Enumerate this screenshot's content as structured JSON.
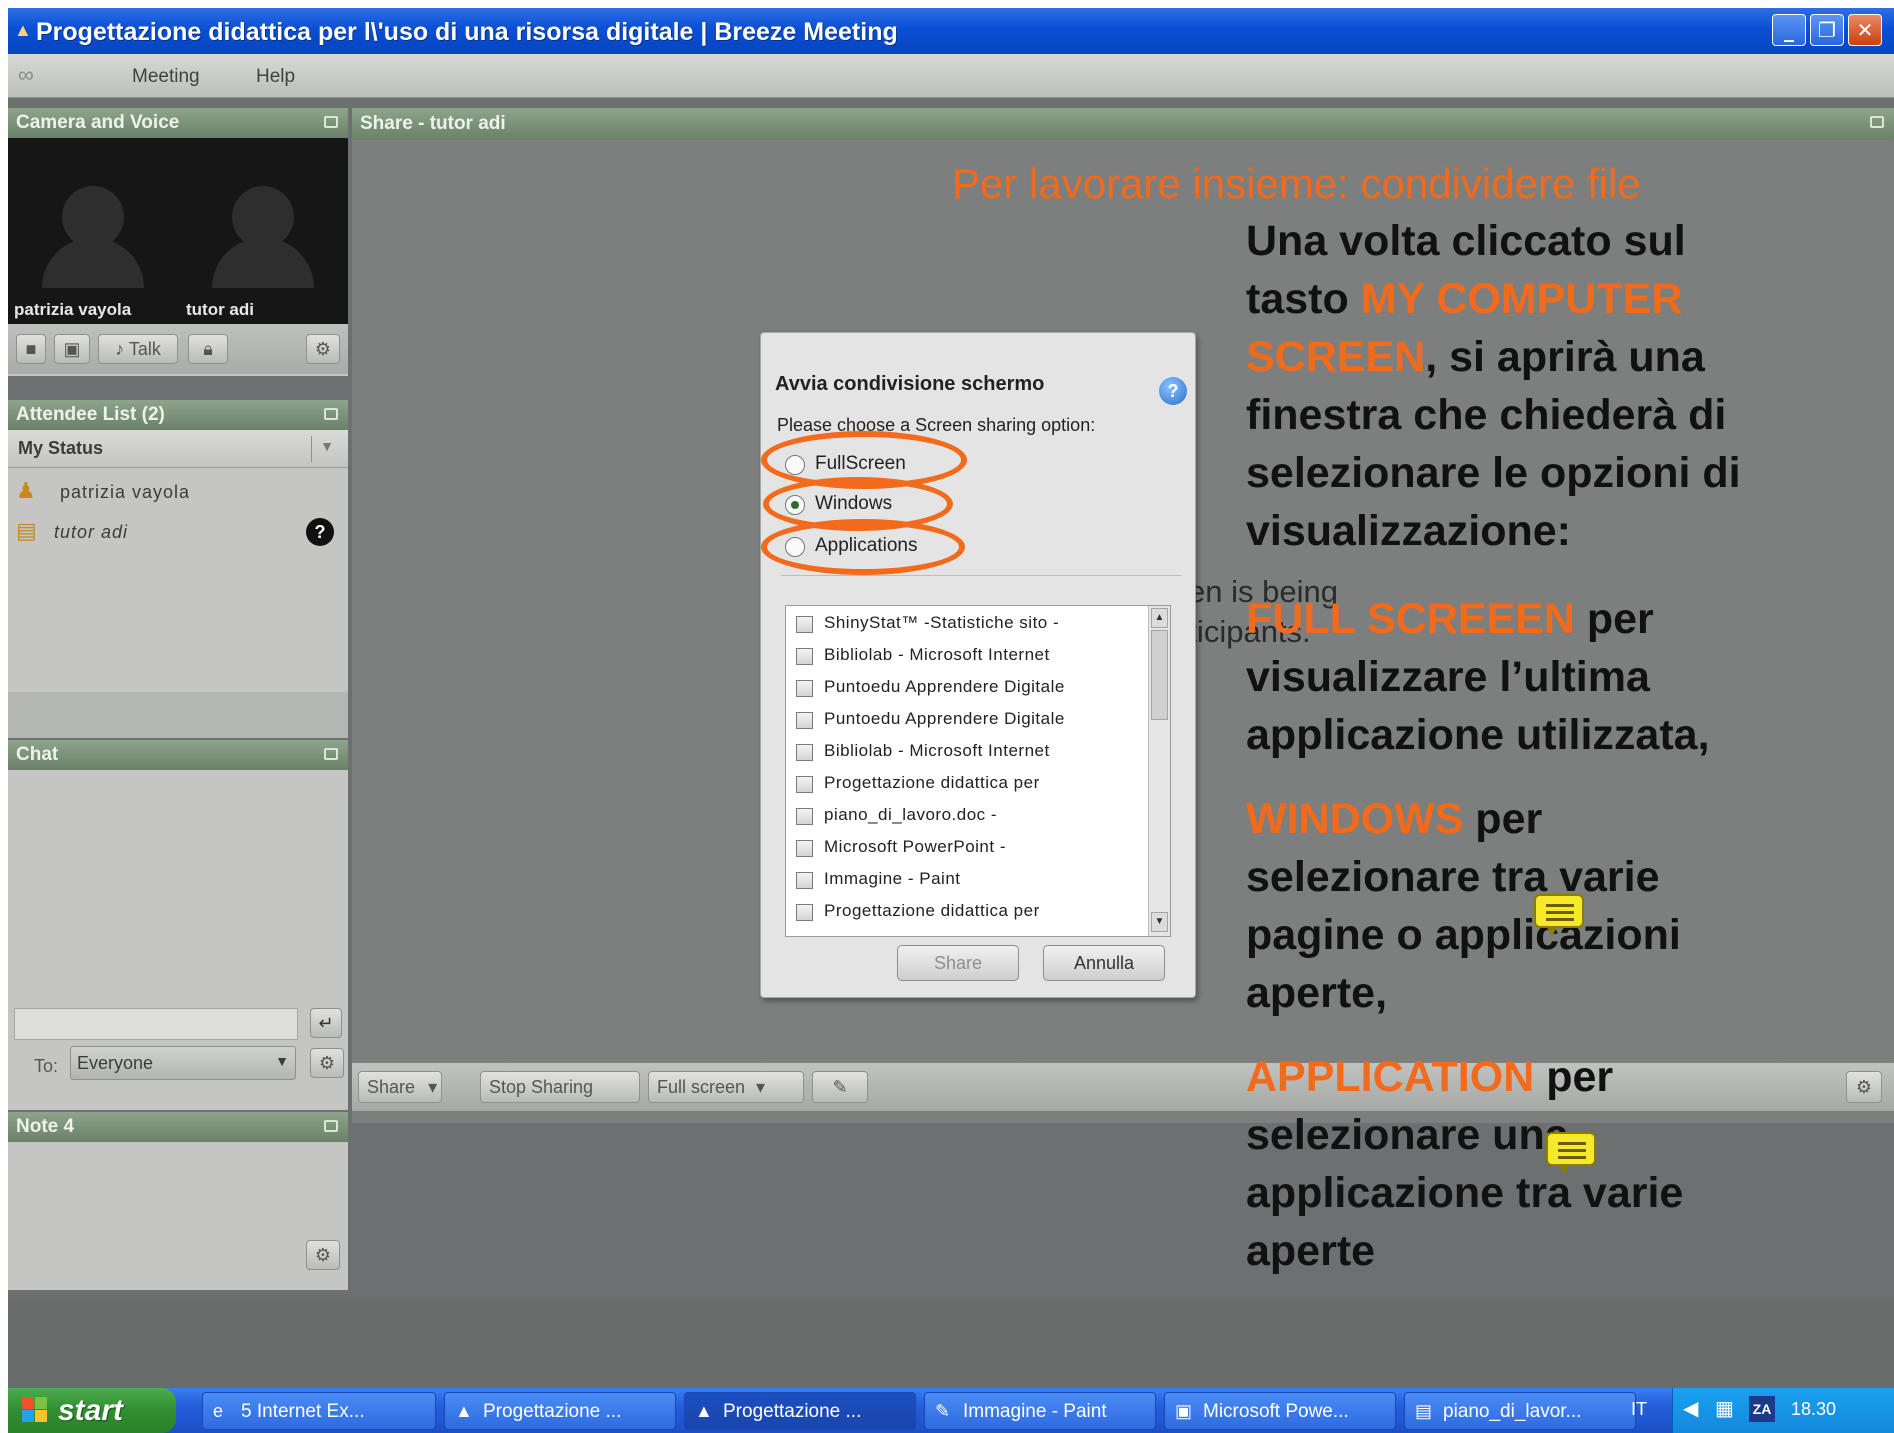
{
  "window": {
    "title": "Progettazione didattica per l\\'uso di una risorsa digitale | Breeze Meeting",
    "minimize": "_",
    "restore": "❐",
    "close": "✕"
  },
  "menu": {
    "logo": "∞",
    "items": [
      "Meeting",
      "Help"
    ]
  },
  "camera_pod": {
    "title": "Camera and Voice",
    "participants": [
      "patrizia vayola",
      "tutor adi"
    ],
    "talk_label": "Talk"
  },
  "attendee_pod": {
    "title": "Attendee List (2)",
    "status_label": "My Status",
    "attendees": [
      {
        "name": "patrizia vayola"
      },
      {
        "name": "tutor adi",
        "badge": "?"
      }
    ]
  },
  "chat_pod": {
    "title": "Chat",
    "to_label": "To:",
    "recipient": "Everyone"
  },
  "note_pod": {
    "title": "Note 4"
  },
  "share_pod": {
    "title": "Share - tutor adi",
    "background_text": [
      "en is being",
      "rticipants."
    ],
    "toolbar": {
      "share": "Share",
      "stop": "Stop Sharing",
      "fullscreen": "Full screen"
    }
  },
  "dialog": {
    "title": "Avvia condivisione schermo",
    "prompt": "Please choose a Screen sharing option:",
    "options": [
      "FullScreen",
      "Windows",
      "Applications"
    ],
    "selected": "Windows",
    "windows": [
      "ShinyStat™ -Statistiche sito -",
      "Bibliolab - Microsoft Internet",
      "Puntoedu Apprendere Digitale",
      "Puntoedu Apprendere Digitale",
      "Bibliolab - Microsoft Internet",
      "Progettazione didattica per",
      "piano_di_lavoro.doc -",
      "Microsoft PowerPoint -",
      "Immagine - Paint",
      "Progettazione didattica per"
    ],
    "share_button": "Share",
    "cancel_button": "Annulla"
  },
  "annotation": {
    "heading": "Per lavorare insieme: condividere file",
    "intro": [
      "Una volta cliccato sul",
      "tasto ",
      "MY COMPUTER",
      "SCREEN",
      ", si aprirà una",
      "finestra che chiederà di",
      "selezionare le opzioni di",
      "visualizzazione:"
    ],
    "full_screen": [
      "FULL SCREEEN",
      " per",
      "visualizzare l’ultima",
      "applicazione utilizzata,"
    ],
    "windows": [
      "WINDOWS",
      " per",
      "selezionare tra varie",
      "pagine o applicazioni",
      "aperte,"
    ],
    "application": [
      "APPLICATION",
      " per",
      "selezionare una",
      "applicazione tra varie",
      "aperte"
    ]
  },
  "taskbar": {
    "start": "start",
    "tasks": [
      "5 Internet Ex...",
      "Progettazione ...",
      "Progettazione ...",
      "Immagine - Paint",
      "Microsoft Powe...",
      "piano_di_lavor..."
    ],
    "lang": "IT",
    "clock": "18.30"
  },
  "colors": {
    "accent": "#f26a1b",
    "pod_header": "#7a9078",
    "taskbar": "#245edb"
  }
}
